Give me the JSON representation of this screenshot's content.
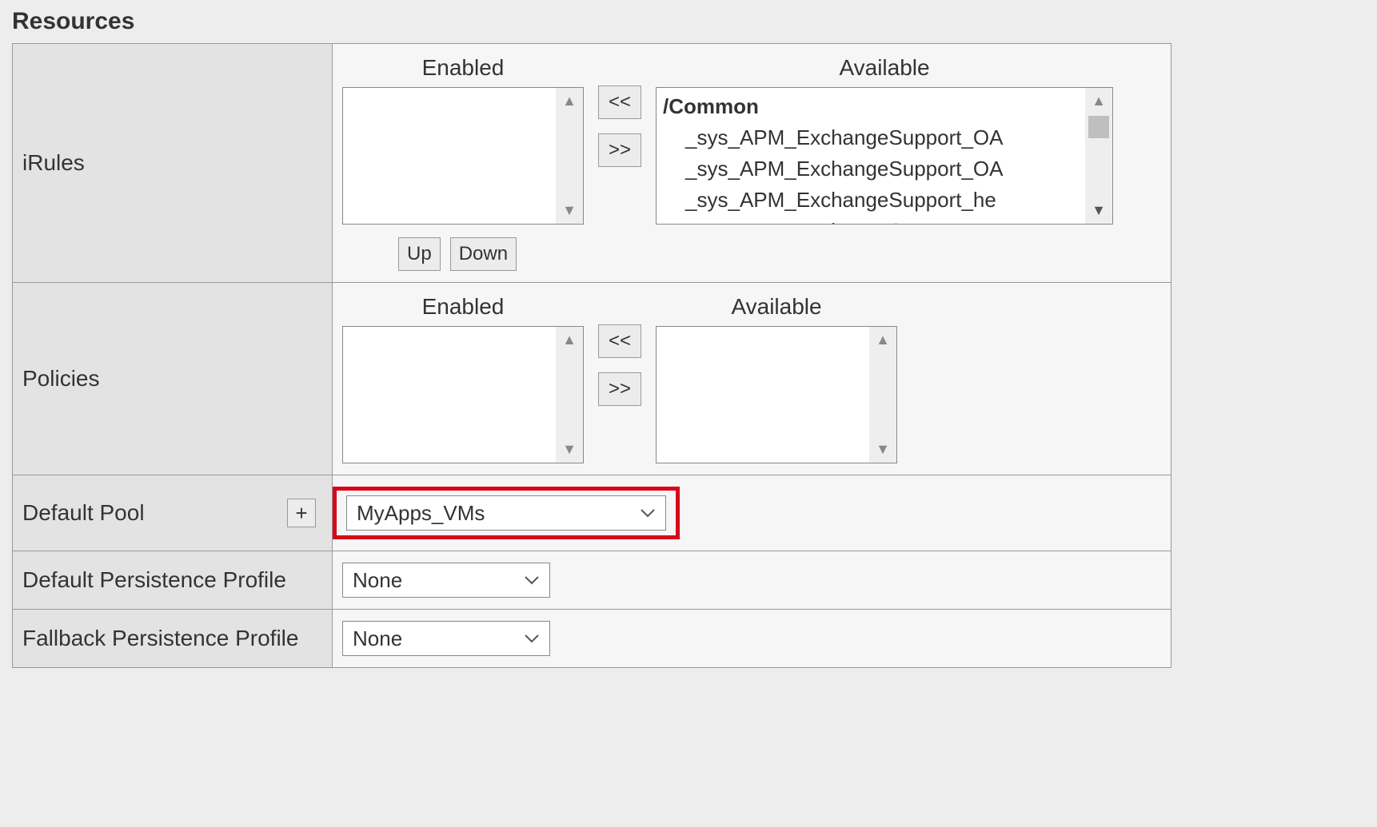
{
  "section_title": "Resources",
  "rows": {
    "irules": {
      "label": "iRules",
      "enabled_header": "Enabled",
      "available_header": "Available",
      "available_group": "/Common",
      "available_items": [
        "_sys_APM_ExchangeSupport_OA",
        "_sys_APM_ExchangeSupport_OA",
        "_sys_APM_ExchangeSupport_he",
        "_sys_APM_ExchangeSupport_ma"
      ],
      "move_left_label": "<<",
      "move_right_label": ">>",
      "up_label": "Up",
      "down_label": "Down"
    },
    "policies": {
      "label": "Policies",
      "enabled_header": "Enabled",
      "available_header": "Available",
      "move_left_label": "<<",
      "move_right_label": ">>"
    },
    "default_pool": {
      "label": "Default Pool",
      "plus_label": "+",
      "value": "MyApps_VMs"
    },
    "default_persistence": {
      "label": "Default Persistence Profile",
      "value": "None"
    },
    "fallback_persistence": {
      "label": "Fallback Persistence Profile",
      "value": "None"
    }
  }
}
